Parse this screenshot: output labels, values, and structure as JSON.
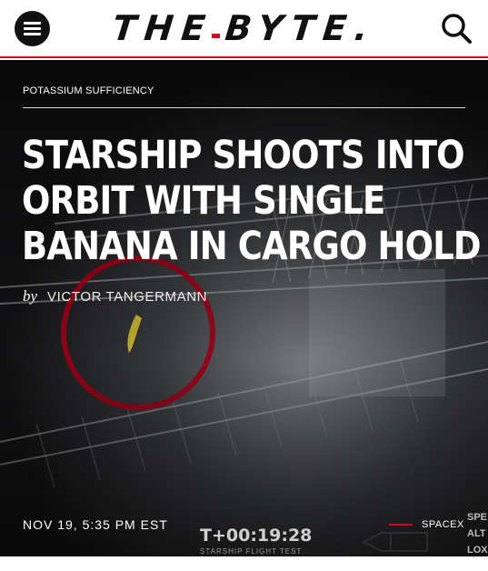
{
  "header": {
    "logo_left": "THE",
    "logo_right": "BYTE.",
    "accent_color": "#d8001f"
  },
  "article": {
    "section": "POTASSIUM SUFFICIENCY",
    "headline_lines": [
      "STARSHIP SHOOTS INTO",
      "ORBIT WITH SINGLE",
      "BANANA IN CARGO HOLD"
    ],
    "byline_prefix": "by",
    "author": "VICTOR TANGERMANN",
    "date": "NOV 19, 5:35 PM EST",
    "tag": "SPACEX"
  },
  "hero_overlay": {
    "timer": "T+00:19:28",
    "subtitle": "STARSHIP FLIGHT TEST",
    "right_labels": [
      "SPE",
      "ALT",
      "LOX"
    ]
  },
  "icons": {
    "menu": "hamburger-menu-icon",
    "search": "search-icon"
  }
}
